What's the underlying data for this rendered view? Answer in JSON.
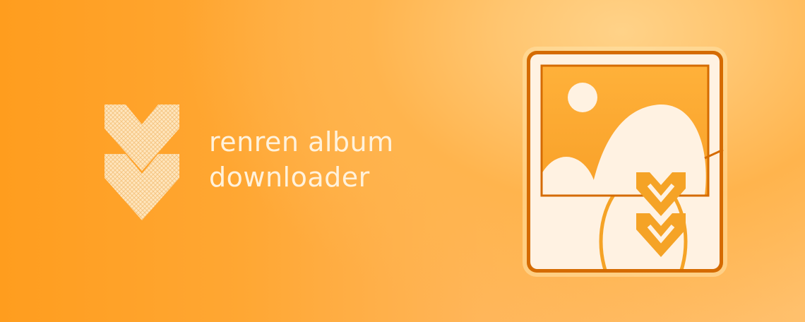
{
  "banner": {
    "title_line1": "renren album",
    "title_line2": "downloader"
  },
  "icons": {
    "left_graphic": "double-chevron-down-icon",
    "right_graphic": "photo-album-download-icon"
  },
  "colors": {
    "background_orange": "#ff9d1e",
    "background_highlight": "#ffd288",
    "icon_frame": "#d56b00",
    "icon_accent": "#f5a326",
    "cream": "#fff2e2",
    "text": "#fff2dc"
  }
}
